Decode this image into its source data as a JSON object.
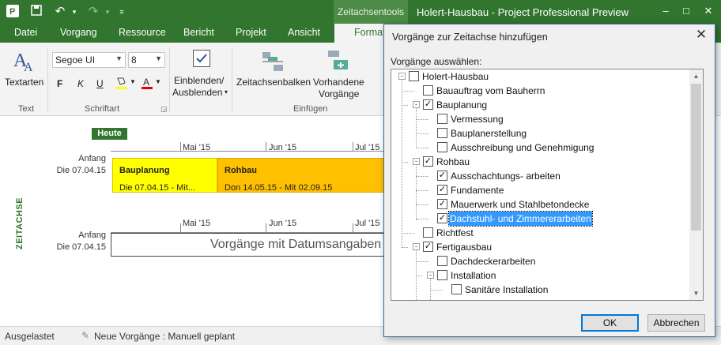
{
  "window": {
    "title": "Holert-Hausbau - Project Professional Preview",
    "context_tab_title": "Zeitachsentools",
    "controls": {
      "minimize": "–",
      "maximize": "□",
      "close": "✕"
    }
  },
  "qat": {
    "save_icon": "save-icon",
    "undo_icon": "undo-icon",
    "redo_icon": "redo-icon"
  },
  "tabs": [
    "Datei",
    "Vorgang",
    "Ressource",
    "Bericht",
    "Projekt",
    "Ansicht"
  ],
  "active_tab": "Format",
  "ribbon": {
    "text_group": {
      "button": "Textarten",
      "name": "Text"
    },
    "font_group": {
      "font": "Segoe UI",
      "size": "8",
      "bold": "F",
      "italic": "K",
      "underline": "U",
      "name": "Schriftart"
    },
    "show_hide": {
      "line1": "Einblenden/",
      "line2": "Ausblenden"
    },
    "insert_group": {
      "timeline_bars": "Zeitachsenbalken",
      "existing_line1": "Vorhandene",
      "existing_line2": "Vorgänge",
      "name": "Einfügen"
    }
  },
  "timeline": {
    "side_label": "ZEITACHSE",
    "today": "Heute",
    "start_label": "Anfang",
    "start_date": "Die 07.04.15",
    "months": [
      "Mai '15",
      "Jun '15",
      "Jul '15"
    ],
    "bars": [
      {
        "name": "Bauplanung",
        "dates": "Die 07.04.15 - Mit...",
        "color": "#ffff00"
      },
      {
        "name": "Rohbau",
        "dates": "Don 14.05.15 - Mit 02.09.15",
        "color": "#ffc000"
      }
    ],
    "placeholder": "Vorgänge mit Datumsangaben"
  },
  "status": {
    "ready": "Ausgelastet",
    "new_tasks": "Neue Vorgänge : Manuell geplant"
  },
  "dialog": {
    "title": "Vorgänge zur Zeitachse hinzufügen",
    "select_label": "Vorgänge auswählen:",
    "ok": "OK",
    "cancel": "Abbrechen",
    "tree": [
      {
        "label": "Holert-Hausbau",
        "level": 0,
        "checked": false,
        "expander": "-"
      },
      {
        "label": "Bauauftrag vom Bauherrn",
        "level": 1,
        "checked": false,
        "expander": ""
      },
      {
        "label": "Bauplanung",
        "level": 1,
        "checked": true,
        "expander": "-"
      },
      {
        "label": "Vermessung",
        "level": 2,
        "checked": false,
        "expander": ""
      },
      {
        "label": "Bauplanerstellung",
        "level": 2,
        "checked": false,
        "expander": ""
      },
      {
        "label": "Ausschreibung und Genehmigung",
        "level": 2,
        "checked": false,
        "expander": ""
      },
      {
        "label": "Rohbau",
        "level": 1,
        "checked": true,
        "expander": "-"
      },
      {
        "label": "Ausschachtungs- arbeiten",
        "level": 2,
        "checked": true,
        "expander": ""
      },
      {
        "label": "Fundamente",
        "level": 2,
        "checked": true,
        "expander": ""
      },
      {
        "label": "Mauerwerk und Stahlbetondecke",
        "level": 2,
        "checked": true,
        "expander": ""
      },
      {
        "label": "Dachstuhl- und Zimmererarbeiten",
        "level": 2,
        "checked": true,
        "expander": "",
        "selected": true
      },
      {
        "label": "Richtfest",
        "level": 1,
        "checked": false,
        "expander": ""
      },
      {
        "label": "Fertigausbau",
        "level": 1,
        "checked": true,
        "expander": "-"
      },
      {
        "label": "Dachdeckerarbeiten",
        "level": 2,
        "checked": false,
        "expander": ""
      },
      {
        "label": "Installation",
        "level": 2,
        "checked": false,
        "expander": "-"
      },
      {
        "label": "Sanitäre Installation",
        "level": 3,
        "checked": false,
        "expander": ""
      }
    ]
  }
}
